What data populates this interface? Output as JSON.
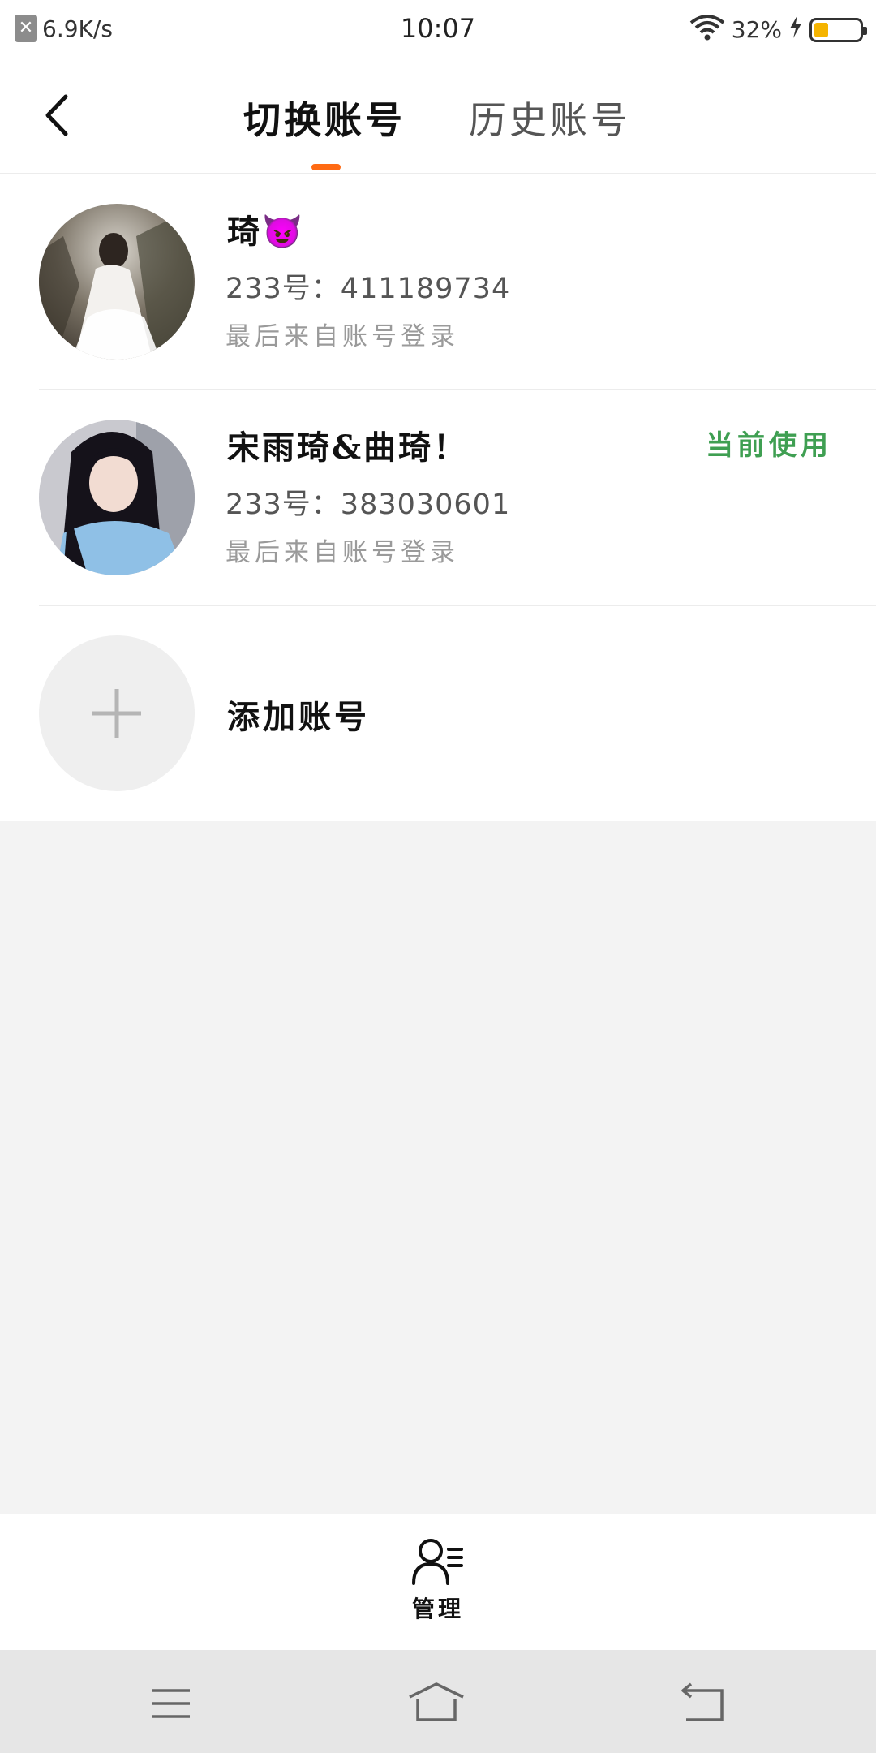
{
  "status_bar": {
    "net_speed": "6.9K/s",
    "time": "10:07",
    "battery_text": "32%",
    "battery_level": 0.32,
    "battery_color": "#f5b400",
    "icons": [
      "close-icon",
      "wifi-icon",
      "charging-icon",
      "battery-icon"
    ]
  },
  "header": {
    "tabs": [
      {
        "label": "切换账号",
        "active": true
      },
      {
        "label": "历史账号",
        "active": false
      }
    ],
    "accent_color": "#ff6a13"
  },
  "accounts": [
    {
      "name": "琦😈",
      "id_text": "233号：411189734",
      "last_login": "最后来自账号登录",
      "current": false
    },
    {
      "name": "宋雨琦&曲琦！",
      "id_text": "233号：383030601",
      "last_login": "最后来自账号登录",
      "current": true,
      "current_label": "当前使用",
      "current_color": "#3f9f52"
    }
  ],
  "add_account": {
    "label": "添加账号"
  },
  "footer": {
    "manage_label": "管理"
  },
  "system_nav": {
    "icons": [
      "menu-icon",
      "home-icon",
      "back-icon"
    ]
  }
}
